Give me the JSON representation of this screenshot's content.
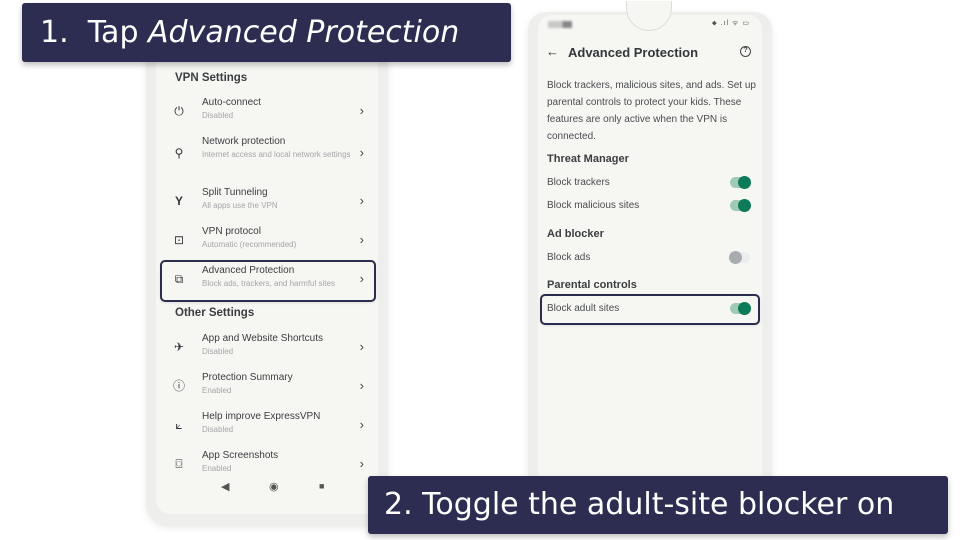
{
  "callouts": {
    "step1_prefix": "1.  Tap ",
    "step1_emphasis": "Advanced Protection",
    "step2": "2. Toggle the adult-site blocker on"
  },
  "left_screen": {
    "sections": [
      {
        "title": "VPN Settings",
        "items": [
          {
            "icon": "power-icon",
            "label": "Auto-connect",
            "sub": "Disabled"
          },
          {
            "icon": "network-protection-icon",
            "label": "Network protection",
            "sub": "Internet access and local network settings"
          },
          {
            "icon": "split-tunneling-icon",
            "label": "Split Tunneling",
            "sub": "All apps use the VPN"
          },
          {
            "icon": "vpn-protocol-icon",
            "label": "VPN protocol",
            "sub": "Automatic (recommended)"
          },
          {
            "icon": "advanced-protection-icon",
            "label": "Advanced Protection",
            "sub": "Block ads, trackers, and harmful sites",
            "highlighted": true
          }
        ]
      },
      {
        "title": "Other Settings",
        "items": [
          {
            "icon": "rocket-icon",
            "label": "App and Website Shortcuts",
            "sub": "Disabled"
          },
          {
            "icon": "info-icon",
            "label": "Protection Summary",
            "sub": "Enabled"
          },
          {
            "icon": "chart-icon",
            "label": "Help improve ExpressVPN",
            "sub": "Disabled"
          },
          {
            "icon": "camera-icon",
            "label": "App Screenshots",
            "sub": "Enabled"
          }
        ]
      }
    ],
    "chevron": "›",
    "nav": {
      "back": "◀",
      "home": "◉",
      "recents": "■"
    }
  },
  "right_screen": {
    "status_icons": "⬥ .ıl ᯤ ▭",
    "back_icon": "←",
    "title": "Advanced Protection",
    "help_icon": "?",
    "description": "Block trackers, malicious sites, and ads. Set up parental controls to protect your kids. These features are only active when the VPN is connected.",
    "sections": [
      {
        "title": "Threat Manager",
        "items": [
          {
            "label": "Block trackers",
            "on": true
          },
          {
            "label": "Block malicious sites",
            "on": true
          }
        ]
      },
      {
        "title": "Ad blocker",
        "items": [
          {
            "label": "Block ads",
            "on": false
          }
        ]
      },
      {
        "title": "Parental controls",
        "items": [
          {
            "label": "Block adult sites",
            "on": true,
            "highlighted": true
          }
        ]
      }
    ],
    "colors": {
      "toggle_on": "#0d7a58",
      "toggle_off": "#a9acaf",
      "highlight": "#2b2d4f"
    }
  }
}
